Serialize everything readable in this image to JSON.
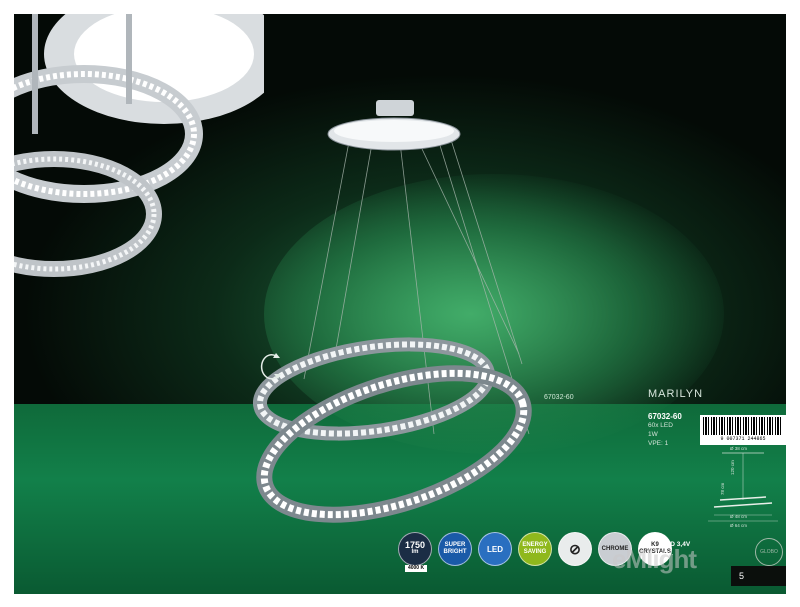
{
  "product": {
    "name": "MARILYN",
    "model": "67032-60",
    "specs": [
      "60x LED",
      "1W",
      "VPE: 1"
    ],
    "callout": "67032-60",
    "barcode_number": "9 007371 244865"
  },
  "dimensions": {
    "width_small": "Ø 38 cm",
    "width_medium": "Ø 48 cm",
    "width_large": "Ø 64 cm",
    "height_1": "120 cm",
    "height_2": "78 cm"
  },
  "icons": {
    "lumen_value": "1750",
    "lumen_unit": "lm",
    "kelvin": "4000 K",
    "super_bright": "SUPER BRIGHT",
    "led": "LED",
    "energy": "ENERGY SAVING",
    "chrome": "CHROME",
    "k9_title": "K9",
    "k9_sub": "CRYSTALS"
  },
  "led_info": {
    "title": "LED 3,4V",
    "sub": "incl."
  },
  "brand_seal": "GLOBO",
  "watermark": "eMlight",
  "page_number": "5",
  "colors": {
    "background_dark": "#040a06",
    "floor_green": "#12804a",
    "accent_blue": "#1a5aa8",
    "energy_green": "#8fb81c"
  }
}
